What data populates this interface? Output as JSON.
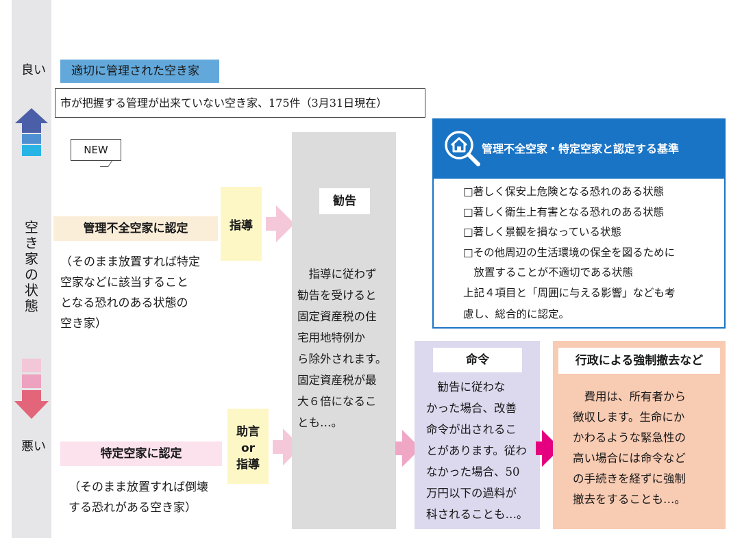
{
  "state_axis": {
    "good_label": "良い",
    "bad_label": "悪い",
    "vertical_label": [
      "空",
      "き",
      "家",
      "の",
      "状",
      "態"
    ]
  },
  "managed_vacant_label": "適切に管理された空き家",
  "unmanaged_note": "市が把握する管理が出来ていない空き家、175件（3月31日現在）",
  "new_badge": "NEW",
  "kanri_fuzen": {
    "label": "管理不全空家に認定",
    "description": [
      "（そのまま放置すれば特定",
      "空家などに該当すること",
      "となる恐れのある状態の",
      "空き家）"
    ]
  },
  "tokutei": {
    "label": "特定空家に認定",
    "description": [
      "（そのまま放置すれば倒壊",
      "する恐れがある空き家）"
    ]
  },
  "step_guidance": "指導",
  "step_advice": [
    "助言",
    "or",
    "指導"
  ],
  "kankoku": {
    "title": "勧告",
    "text": [
      "　指導に従わず",
      "勧告を受けると",
      "固定資産税の住",
      "宅用地特例か",
      "ら除外されます。",
      "固定資産税が最",
      "大６倍になるこ",
      "とも…。"
    ]
  },
  "criteria": {
    "title": "管理不全空家・特定空家と認定する基準",
    "items": [
      "□著しく保安上危険となる恐れのある状態",
      "□著しく衛生上有害となる恐れのある状態",
      "□著しく景観を損なっている状態",
      "□その他周辺の生活環境の保全を図るために",
      "　放置することが不適切である状態"
    ],
    "footer": [
      "上記４項目と「周囲に与える影響」なども考",
      "慮し、総合的に認定。"
    ]
  },
  "meirei": {
    "title": "命令",
    "text": [
      "　勧告に従わな",
      "かった場合、改善",
      "命令が出されるこ",
      "とがあります。従わ",
      "なかった場合、50",
      "万円以下の過料が",
      "科されることも…。"
    ]
  },
  "gyosei": {
    "title": "行政による強制撤去など",
    "text": [
      "　費用は、所有者から",
      "徴収します。生命にか",
      "かわるような緊急性の",
      "高い場合には命令など",
      "の手続きを経ずに強制",
      "撤去をすることも…。"
    ]
  },
  "colors": {
    "rail": "#e6e6e9",
    "blue_accent": "#1a74c5",
    "arrow_up": "#4b5fa8",
    "arrow_down": "#e3657a",
    "final_arrow": "#e4007f"
  }
}
